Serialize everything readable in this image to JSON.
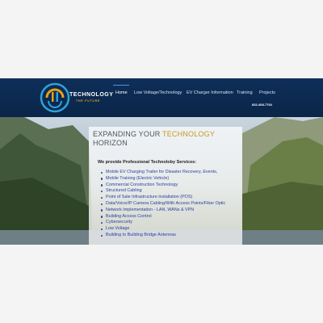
{
  "header": {
    "brand_text": "TECHNOLOGY",
    "brand_tagline": "THE FUTURE",
    "phone": "832-408-7764",
    "nav": [
      {
        "label": "Home",
        "active": true
      },
      {
        "label": "Low Voltage/Technology"
      },
      {
        "label": "EV Charger Information"
      },
      {
        "label": "Training"
      },
      {
        "label": "Projects"
      }
    ],
    "colors": {
      "background": "#0e2f5a",
      "accent": "#e6a21a"
    }
  },
  "hero": {
    "heading_part1": "EXPANDING YOUR ",
    "heading_highlight": "TECHNOLOGY",
    "heading_part2": "HORIZON",
    "intro": "We provide Professional Technoloby Services:",
    "services": [
      "Mobile EV Charging Trailer for Disaster Recovery, Events,",
      "Mobile Training (Electric Vehicle)",
      "Commercial Construction Technology",
      "Structured Cabling",
      "Point of Sale Infrastructure installation (POS)",
      "Data/Voice/IP Camera Cabling/With Access Points/Fiber Optic",
      "Network Implementation - LAN, WANs & VPN",
      "Building Access Control",
      "Cybersecurity",
      "Low Voltage",
      "Building to Building Bridge Antennas"
    ],
    "colors": {
      "heading": "#4a5560",
      "highlight": "#c49a1a",
      "list": "#2c3fa0"
    }
  }
}
